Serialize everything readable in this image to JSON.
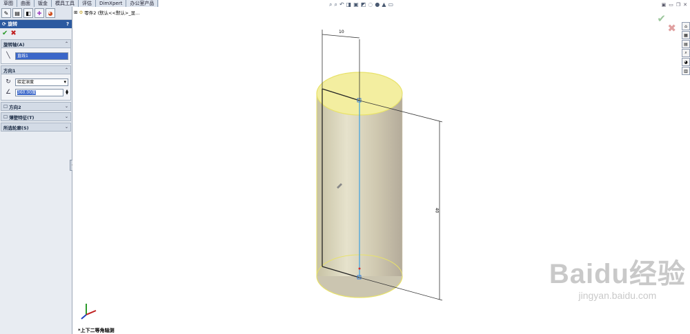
{
  "tabs": [
    "草图",
    "曲面",
    "钣金",
    "模具工具",
    "评估",
    "DimXpert",
    "办公室产品"
  ],
  "panel": {
    "icons": [
      "feature-manager-icon",
      "property-manager-icon",
      "config-manager-icon",
      "dimxpert-icon",
      "display-manager-icon"
    ],
    "title": "旋转",
    "help": "?",
    "groups": {
      "axis": {
        "label": "旋转轴(A)",
        "value": "直线1"
      },
      "direction1": {
        "label": "方向1",
        "type": "给定深度",
        "angle": "360.00度"
      },
      "direction2": {
        "label": "方向2"
      },
      "thin": {
        "label": "薄壁特征(T)"
      },
      "contours": {
        "label": "所选轮廓(S)"
      }
    }
  },
  "viewport": {
    "tree_label": "零件2 (默认<<默认>_显...",
    "view_name": "*上下二等角轴测",
    "dim_top": "10",
    "dim_right": "40"
  },
  "watermark": {
    "brand": "Baidu经验",
    "url": "jingyan.baidu.com"
  },
  "colors": {
    "accent": "#2c5aa0",
    "cylinder": "#d8d2b4",
    "edge_highlight": "#e8e26a",
    "centerline": "#3aa0e0"
  }
}
